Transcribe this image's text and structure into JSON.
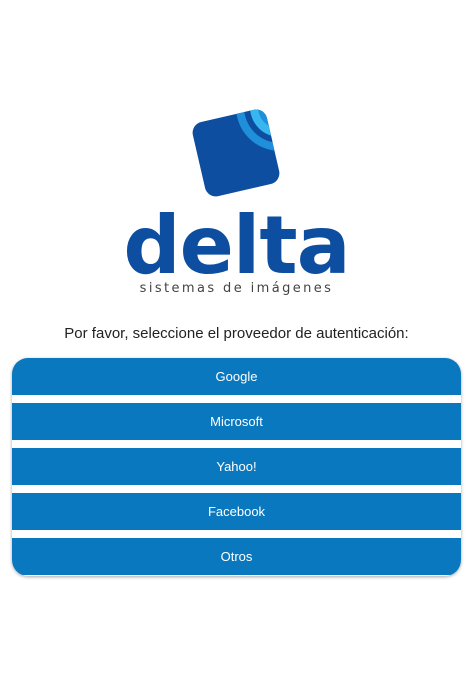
{
  "logo": {
    "wordmark": "delta",
    "tagline": "sistemas de imágenes",
    "colors": {
      "primary": "#0e4ea1",
      "accent_light": "#38b6f0",
      "accent_mid": "#1e8fd8"
    }
  },
  "prompt": "Por favor, seleccione el proveedor de autenticación:",
  "providers": [
    {
      "label": "Google"
    },
    {
      "label": "Microsoft"
    },
    {
      "label": "Yahoo!"
    },
    {
      "label": "Facebook"
    },
    {
      "label": "Otros"
    }
  ],
  "colors": {
    "button_background": "#0a78bf",
    "button_text": "#ffffff",
    "page_background": "#ffffff"
  }
}
